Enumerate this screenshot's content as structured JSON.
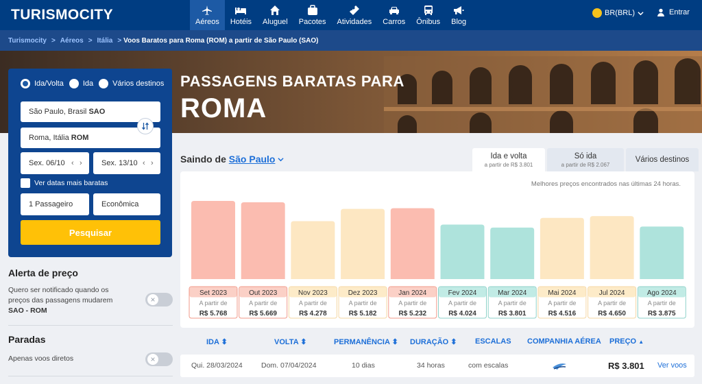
{
  "header": {
    "logo": "TURISMOCITY",
    "nav": [
      {
        "label": "Aéreos",
        "icon": "plane-icon",
        "active": true
      },
      {
        "label": "Hotéis",
        "icon": "bed-icon",
        "active": false
      },
      {
        "label": "Aluguel",
        "icon": "home-icon",
        "active": false
      },
      {
        "label": "Pacotes",
        "icon": "suitcase-icon",
        "active": false
      },
      {
        "label": "Atividades",
        "icon": "ticket-icon",
        "active": false
      },
      {
        "label": "Carros",
        "icon": "car-icon",
        "active": false
      },
      {
        "label": "Ônibus",
        "icon": "bus-icon",
        "active": false
      },
      {
        "label": "Blog",
        "icon": "megaphone-icon",
        "active": false
      }
    ],
    "currency": "BR(BRL)",
    "login": "Entrar"
  },
  "breadcrumb": {
    "items": [
      "Turismocity",
      "Aéreos",
      "Itália"
    ],
    "current": "Voos Baratos para Roma (ROM) a partir de São Paulo (SAO)"
  },
  "hero": {
    "kicker": "PASSAGENS BARATAS PARA",
    "title": "ROMA"
  },
  "search": {
    "trip_types": [
      {
        "label": "Ida/Volta",
        "selected": true
      },
      {
        "label": "Ida",
        "selected": false
      },
      {
        "label": "Vários destinos",
        "selected": false
      }
    ],
    "origin": {
      "city": "São Paulo, Brasil ",
      "code": "SAO"
    },
    "destination": {
      "city": "Roma, Itália ",
      "code": "ROM"
    },
    "depart": "Sex. 06/10",
    "return": "Sex. 13/10",
    "flexible_label": "Ver datas mais baratas",
    "passengers": "1 Passageiro",
    "cabin": "Econômica",
    "submit": "Pesquisar"
  },
  "alert": {
    "title": "Alerta de preço",
    "text1": "Quero ser notificado quando os",
    "text2": "preços das passagens mudarem",
    "route": "SAO - ROM"
  },
  "stops": {
    "title": "Paradas",
    "option": "Apenas voos diretos"
  },
  "origin_selector": {
    "prefix": "Saindo de",
    "city": "São Paulo"
  },
  "tabs": [
    {
      "label": "Ida e volta",
      "sub": "a partir de R$ 3.801",
      "active": true
    },
    {
      "label": "Só ida",
      "sub": "a partir de R$ 2.067",
      "active": false
    },
    {
      "label": "Vários destinos",
      "sub": "",
      "active": false
    }
  ],
  "chart_note": "Melhores preços encontrados nas últimas 24 horas.",
  "chart_data": {
    "type": "bar",
    "categories": [
      "Set 2023",
      "Out 2023",
      "Nov 2023",
      "Dez 2023",
      "Jan 2024",
      "Fev 2024",
      "Mar 2024",
      "Mai 2024",
      "Jul 2024",
      "Ago 2024"
    ],
    "values": [
      5768,
      5669,
      4278,
      5182,
      5232,
      4024,
      3801,
      4516,
      4650,
      3875
    ],
    "labels": [
      "R$ 5.768",
      "R$ 5.669",
      "R$ 4.278",
      "R$ 5.182",
      "R$ 5.232",
      "R$ 4.024",
      "R$ 3.801",
      "R$ 4.516",
      "R$ 4.650",
      "R$ 3.875"
    ],
    "tiers": [
      "high",
      "high",
      "mid",
      "mid",
      "high",
      "low",
      "low",
      "mid",
      "mid",
      "low"
    ],
    "prefix": "A partir de",
    "colors": {
      "high": {
        "bar": "#fbbcb0",
        "border": "#f29a8a",
        "head": "#fbd0c6"
      },
      "mid": {
        "bar": "#fde7c2",
        "border": "#f5d7a3",
        "head": "#fdebc8"
      },
      "low": {
        "bar": "#aee3dc",
        "border": "#8fd2c9",
        "head": "#c1ebe5"
      }
    }
  },
  "results": {
    "columns": [
      {
        "label": "IDA",
        "sort": "⬍"
      },
      {
        "label": "VOLTA",
        "sort": "⬍"
      },
      {
        "label": "PERMANÊNCIA",
        "sort": "⬍"
      },
      {
        "label": "DURAÇÃO",
        "sort": "⬍"
      },
      {
        "label": "ESCALAS",
        "sort": ""
      },
      {
        "label": "COMPANHIA AÉREA",
        "sort": ""
      },
      {
        "label": "PREÇO",
        "sort": "▲"
      }
    ],
    "rows": [
      {
        "depart": "Qui. 28/03/2024",
        "return": "Dom. 07/04/2024",
        "stay": "10 dias",
        "duration": "34 horas",
        "stops": "com escalas",
        "airline_icon": "airline-logo-icon",
        "price": "R$ 3.801",
        "action": "Ver voos"
      }
    ]
  }
}
